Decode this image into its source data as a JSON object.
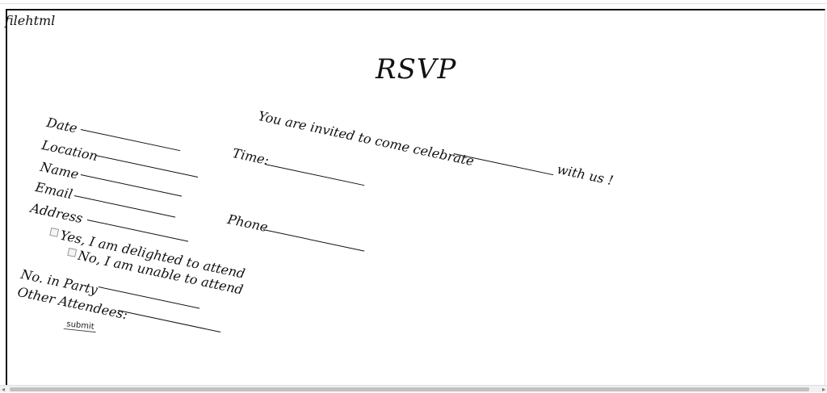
{
  "document_label": "filehtml",
  "title": "RSVP",
  "form": {
    "date_label": "Date",
    "location_label": "Location",
    "name_label": "Name",
    "email_label": "Email",
    "address_label": "Address",
    "yes_label": "Yes, I am delighted to attend",
    "no_label": "No, I am unable to attend",
    "party_label": "No. in Party",
    "other_label": "Other Attendees:",
    "submit_label": "submit"
  },
  "invite": {
    "text": "You are invited to come celebrate",
    "suffix": "with us !",
    "time_label": "Time:",
    "phone_label": "Phone"
  }
}
